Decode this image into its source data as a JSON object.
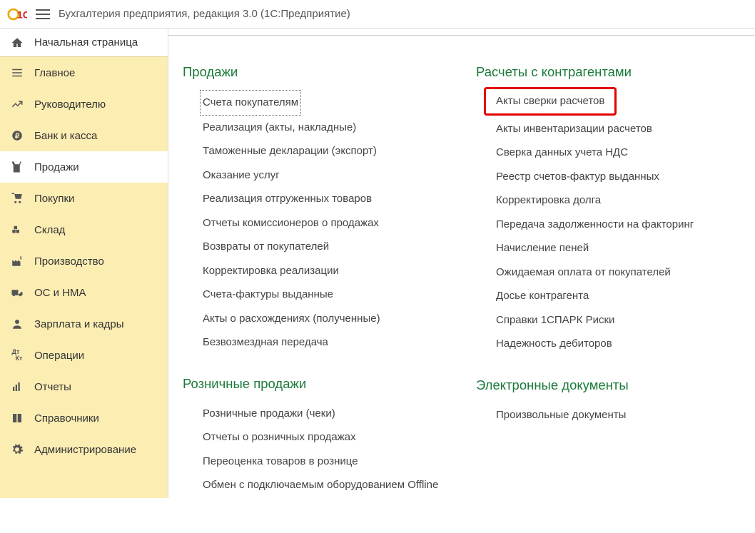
{
  "titlebar": {
    "app_title": "Бухгалтерия предприятия, редакция 3.0   (1С:Предприятие)"
  },
  "sidebar": {
    "home": "Начальная страница",
    "items": [
      {
        "label": "Главное",
        "icon": "menu-icon"
      },
      {
        "label": "Руководителю",
        "icon": "trend-icon"
      },
      {
        "label": "Банк и касса",
        "icon": "ruble-icon"
      },
      {
        "label": "Продажи",
        "icon": "shop-icon",
        "active": true
      },
      {
        "label": "Покупки",
        "icon": "cart-icon"
      },
      {
        "label": "Склад",
        "icon": "warehouse-icon"
      },
      {
        "label": "Производство",
        "icon": "factory-icon"
      },
      {
        "label": "ОС и НМА",
        "icon": "truck-icon"
      },
      {
        "label": "Зарплата и кадры",
        "icon": "person-icon"
      },
      {
        "label": "Операции",
        "icon": "dtkt-icon"
      },
      {
        "label": "Отчеты",
        "icon": "report-icon"
      },
      {
        "label": "Справочники",
        "icon": "book-icon"
      },
      {
        "label": "Администрирование",
        "icon": "gear-icon"
      }
    ]
  },
  "content": {
    "columns": [
      {
        "sections": [
          {
            "title": "Продажи",
            "links": [
              {
                "label": "Счета покупателям",
                "selected": true
              },
              {
                "label": "Реализация (акты, накладные)"
              },
              {
                "label": "Таможенные декларации (экспорт)"
              },
              {
                "label": "Оказание услуг"
              },
              {
                "label": "Реализация отгруженных товаров"
              },
              {
                "label": "Отчеты комиссионеров о продажах"
              },
              {
                "label": "Возвраты от покупателей"
              },
              {
                "label": "Корректировка реализации"
              },
              {
                "label": "Счета-фактуры выданные"
              },
              {
                "label": "Акты о расхождениях (полученные)"
              },
              {
                "label": "Безвозмездная передача"
              }
            ]
          },
          {
            "title": "Розничные продажи",
            "links": [
              {
                "label": "Розничные продажи (чеки)"
              },
              {
                "label": "Отчеты о розничных продажах"
              },
              {
                "label": "Переоценка товаров в рознице"
              },
              {
                "label": "Обмен с подключаемым оборудованием Offline"
              }
            ]
          }
        ]
      },
      {
        "sections": [
          {
            "title": "Расчеты с контрагентами",
            "links": [
              {
                "label": "Акты сверки расчетов",
                "highlight": true
              },
              {
                "label": "Акты инвентаризации расчетов"
              },
              {
                "label": "Сверка данных учета НДС"
              },
              {
                "label": "Реестр счетов-фактур выданных"
              },
              {
                "label": "Корректировка долга"
              },
              {
                "label": "Передача задолженности на факторинг"
              },
              {
                "label": "Начисление пеней"
              },
              {
                "label": "Ожидаемая оплата от покупателей"
              },
              {
                "label": "Досье контрагента"
              },
              {
                "label": "Справки 1СПАРК Риски"
              },
              {
                "label": "Надежность дебиторов"
              }
            ]
          },
          {
            "title": "Электронные документы",
            "links": [
              {
                "label": "Произвольные документы"
              }
            ]
          }
        ]
      }
    ]
  },
  "icons": {
    "dtkt_text": "Дт Кт"
  }
}
